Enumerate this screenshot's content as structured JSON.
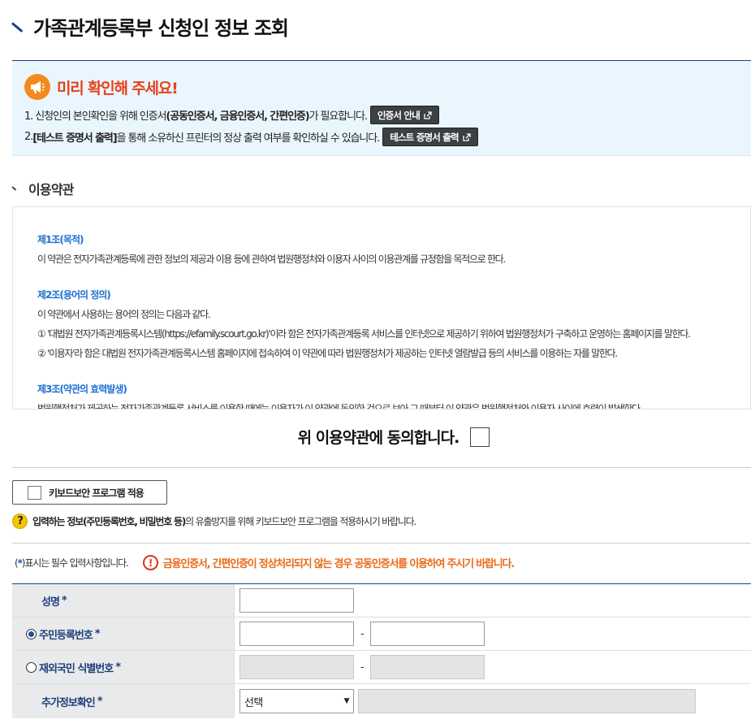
{
  "page": {
    "title": "가족관계등록부 신청인 정보 조회"
  },
  "notice": {
    "title": "미리 확인해 주세요!",
    "line1_prefix": "1. 신청인의 본인확인을 위해 인증서",
    "line1_bold": "(공동인증서, 금융인증서, 간편인증)",
    "line1_suffix": "가 필요합니다.",
    "line1_button": "인증서 안내",
    "line2_prefix": "2. ",
    "line2_bold": "[테스트 증명서 출력]",
    "line2_suffix": "을 통해 소유하신 프린터의 정상 출력 여부를 확인하실 수 있습니다.",
    "line2_button": "테스트 증명서 출력"
  },
  "terms": {
    "section_title": "이용약관",
    "items": [
      {
        "head": "제1조(목적)",
        "lines": [
          "이 약관은 전자가족관계등록에 관한 정보의 제공과 이용 등에 관하여 법원행정처와 이용자 사이의 이용관계를 규정함을 목적으로 한다."
        ]
      },
      {
        "head": "제2조(용어의 정의)",
        "lines": [
          "이 약관에서 사용하는 용어의 정의는 다음과 같다.",
          "① '대법원 전자가족관계등록시스템(https://efamily.scourt.go.kr)'이라 함은 전자가족관계등록 서비스를 인터넷으로 제공하기 위하여 법원행정처가 구축하고 운영하는 홈페이지를 말한다.",
          "② '이용자'라 함은 대법원 전자가족관계등록시스템 홈페이지에 접속하여 이 약관에 따라 법원행정처가 제공하는 인터넷 열람발급 등의 서비스를 이용하는 자를 말한다."
        ]
      },
      {
        "head": "제3조(약관의 효력발생)",
        "lines": [
          "법원행정처가 제공하는 전자가족관계등록 서비스를 이용한 때에는 이용자가 이 약관에 동의한 것으로 보아 그 때부터 이 약관은 법원행정처와 이용자 사이에 효력이 발생한다."
        ]
      }
    ],
    "agree_label": "위 이용약관에 동의합니다."
  },
  "keyboard": {
    "button_label": "키보드보안 프로그램 적용",
    "note_bold": "입력하는 정보(주민등록번호, 비밀번호 등)",
    "note_rest": "의 유출방지를 위해 키보드보안 프로그램을 적용하시기 바랍니다."
  },
  "required_note": {
    "prefix": "(",
    "star": "*",
    "suffix": ")표시는 필수 입력사항입니다.",
    "warning": "금융인증서, 간편인증이 정상처리되지 않는 경우 공동인증서를 이용하여 주시기 바랍니다."
  },
  "form": {
    "star": "*",
    "name_label": "성명",
    "rrn_label": "주민등록번호",
    "foreign_label": "재외국민 식별번호",
    "extra_label": "추가정보확인",
    "dash": "-",
    "select_value": "선택",
    "rrn_selected": true
  },
  "icons": {
    "title": "title-slash-icon",
    "notice": "megaphone-icon",
    "external": "external-link-icon",
    "help": "question-icon",
    "warning": "exclamation-icon"
  },
  "colors": {
    "accent": "#1a3e8a",
    "notice_bg": "#eaf6fd",
    "notice_title": "#e64219",
    "term_head": "#1e6fd0",
    "warning": "#e86a19",
    "label_bg": "#e9eaec"
  }
}
